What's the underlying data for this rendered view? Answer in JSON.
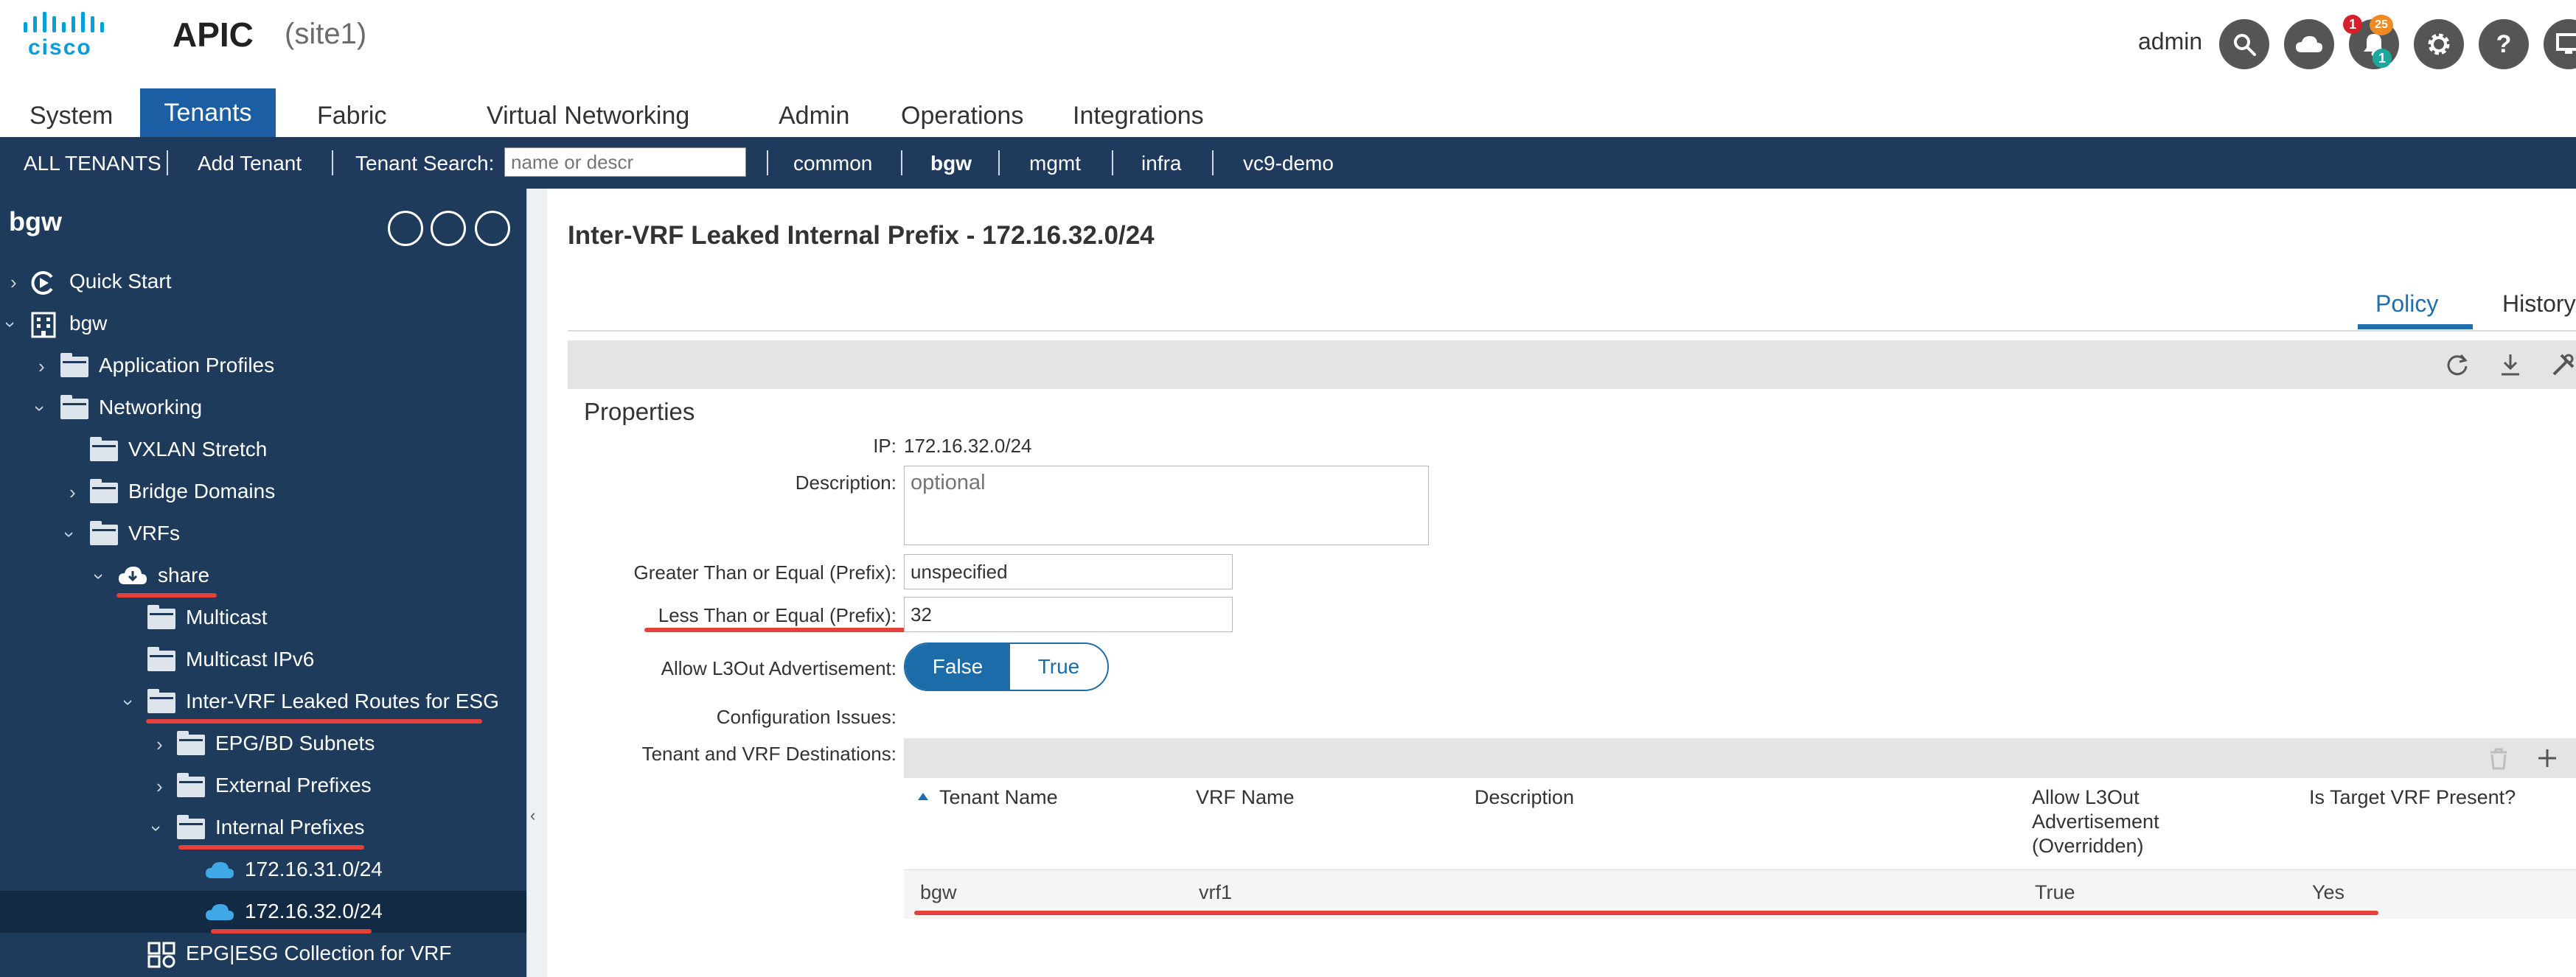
{
  "header": {
    "logo_text": "cisco",
    "app_title": "APIC",
    "site": "(site1)",
    "username": "admin",
    "icons": [
      "search-icon",
      "cloud-icon",
      "bell-icon",
      "gear-icon",
      "help-icon",
      "screen-icon"
    ],
    "alert_badges": {
      "red": "1",
      "orange": "25",
      "teal": "1"
    }
  },
  "main_tabs": [
    "System",
    "Tenants",
    "Fabric",
    "Virtual Networking",
    "Admin",
    "Operations",
    "Integrations"
  ],
  "subnav": {
    "all_tenants": "ALL TENANTS",
    "add_tenant": "Add Tenant",
    "search_label": "Tenant Search:",
    "search_placeholder": "name or descr",
    "tenants": [
      "common",
      "bgw",
      "mgmt",
      "infra",
      "vc9-demo"
    ]
  },
  "sidebar": {
    "title": "bgw",
    "tree": [
      {
        "label": "Quick Start"
      },
      {
        "label": "bgw"
      },
      {
        "label": "Application Profiles"
      },
      {
        "label": "Networking"
      },
      {
        "label": "VXLAN Stretch"
      },
      {
        "label": "Bridge Domains"
      },
      {
        "label": "VRFs"
      },
      {
        "label": "share"
      },
      {
        "label": "Multicast"
      },
      {
        "label": "Multicast IPv6"
      },
      {
        "label": "Inter-VRF Leaked Routes for ESG"
      },
      {
        "label": "EPG/BD Subnets"
      },
      {
        "label": "External Prefixes"
      },
      {
        "label": "Internal Prefixes"
      },
      {
        "label": "172.16.31.0/24"
      },
      {
        "label": "172.16.32.0/24"
      },
      {
        "label": "EPG|ESG Collection for VRF"
      }
    ]
  },
  "content": {
    "title": "Inter-VRF Leaked Internal Prefix - 172.16.32.0/24",
    "tabs": [
      "Policy",
      "History"
    ],
    "properties_title": "Properties",
    "fields": {
      "ip_label": "IP:",
      "ip_value": "172.16.32.0/24",
      "description_label": "Description:",
      "description_placeholder": "optional",
      "ge_label": "Greater Than or Equal (Prefix):",
      "ge_value": "unspecified",
      "le_label": "Less Than or Equal (Prefix):",
      "le_value": "32",
      "allow_label": "Allow L3Out Advertisement:",
      "allow_false": "False",
      "allow_true": "True",
      "config_issues_label": "Configuration Issues:",
      "destinations_label": "Tenant and VRF Destinations:"
    },
    "table": {
      "columns": [
        "Tenant Name",
        "VRF Name",
        "Description",
        "Allow L3Out Advertisement (Overridden)",
        "Is Target VRF Present?"
      ],
      "rows": [
        {
          "tenant": "bgw",
          "vrf": "vrf1",
          "description": "",
          "allow": "True",
          "present": "Yes"
        }
      ]
    }
  },
  "colors": {
    "accent": "#1b6ca8",
    "nav_bg": "#1f3a5c",
    "sidebar_bg": "#1e3b5c",
    "highlight": "#e6403a"
  }
}
